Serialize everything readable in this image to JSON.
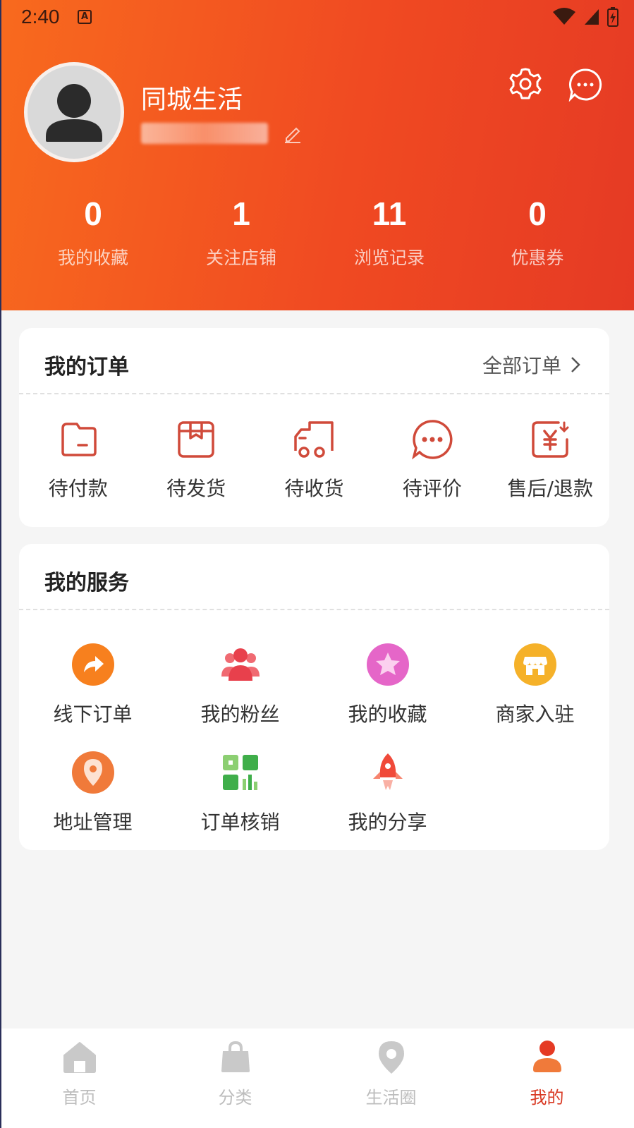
{
  "status_bar": {
    "time": "2:40",
    "notif_letter": "A"
  },
  "profile": {
    "name": "同城生活"
  },
  "stats": [
    {
      "value": "0",
      "label": "我的收藏"
    },
    {
      "value": "1",
      "label": "关注店铺"
    },
    {
      "value": "11",
      "label": "浏览记录"
    },
    {
      "value": "0",
      "label": "优惠券"
    }
  ],
  "orders": {
    "title": "我的订单",
    "all_link": "全部订单",
    "items": [
      {
        "label": "待付款",
        "icon": "wallet-icon"
      },
      {
        "label": "待发货",
        "icon": "package-icon"
      },
      {
        "label": "待收货",
        "icon": "truck-icon"
      },
      {
        "label": "待评价",
        "icon": "comment-icon"
      },
      {
        "label": "售后/退款",
        "icon": "refund-icon"
      }
    ]
  },
  "services": {
    "title": "我的服务",
    "items": [
      {
        "label": "线下订单",
        "icon": "arrow-share-icon"
      },
      {
        "label": "我的粉丝",
        "icon": "users-icon"
      },
      {
        "label": "我的收藏",
        "icon": "star-icon"
      },
      {
        "label": "商家入驻",
        "icon": "store-icon"
      },
      {
        "label": "地址管理",
        "icon": "location-icon"
      },
      {
        "label": "订单核销",
        "icon": "qrcode-icon"
      },
      {
        "label": "我的分享",
        "icon": "rocket-icon"
      }
    ]
  },
  "tabbar": [
    {
      "label": "首页",
      "icon": "home-icon"
    },
    {
      "label": "分类",
      "icon": "bag-icon"
    },
    {
      "label": "生活圈",
      "icon": "map-pin-icon"
    },
    {
      "label": "我的",
      "icon": "user-icon",
      "active": true
    }
  ],
  "colors": {
    "brand": "#e53a24",
    "accent_orange": "#f86a1e",
    "icon_red": "#d04a3a"
  }
}
